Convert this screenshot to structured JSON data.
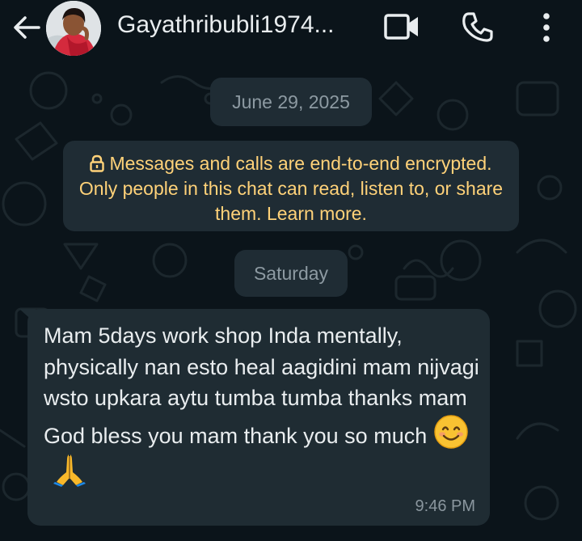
{
  "header": {
    "contact_name": "Gayathribubli1974...",
    "back_icon": "arrow-left-icon",
    "video_icon": "video-camera-icon",
    "call_icon": "phone-icon",
    "menu_icon": "more-vertical-icon"
  },
  "date_separator": "June 29, 2025",
  "encryption_notice": "Messages and calls are end-to-end encrypted. Only people in this chat can read, listen to, or share them. Learn more.",
  "day_separator": "Saturday",
  "message": {
    "text": "Mam 5days work shop Inda mentally, physically nan esto heal aagidini mam nijvagi wsto upkara aytu tumba tumba thanks mam God bless you mam thank you so much",
    "emojis": [
      "smiling-face-icon",
      "folded-hands-icon"
    ],
    "time": "9:46 PM"
  },
  "colors": {
    "background": "#0b141a",
    "bubble": "#1f2c33",
    "pill": "#1f2c34",
    "encryption_text": "#ffd279",
    "primary_text": "#e9edef",
    "secondary_text": "#8d9aa2"
  }
}
